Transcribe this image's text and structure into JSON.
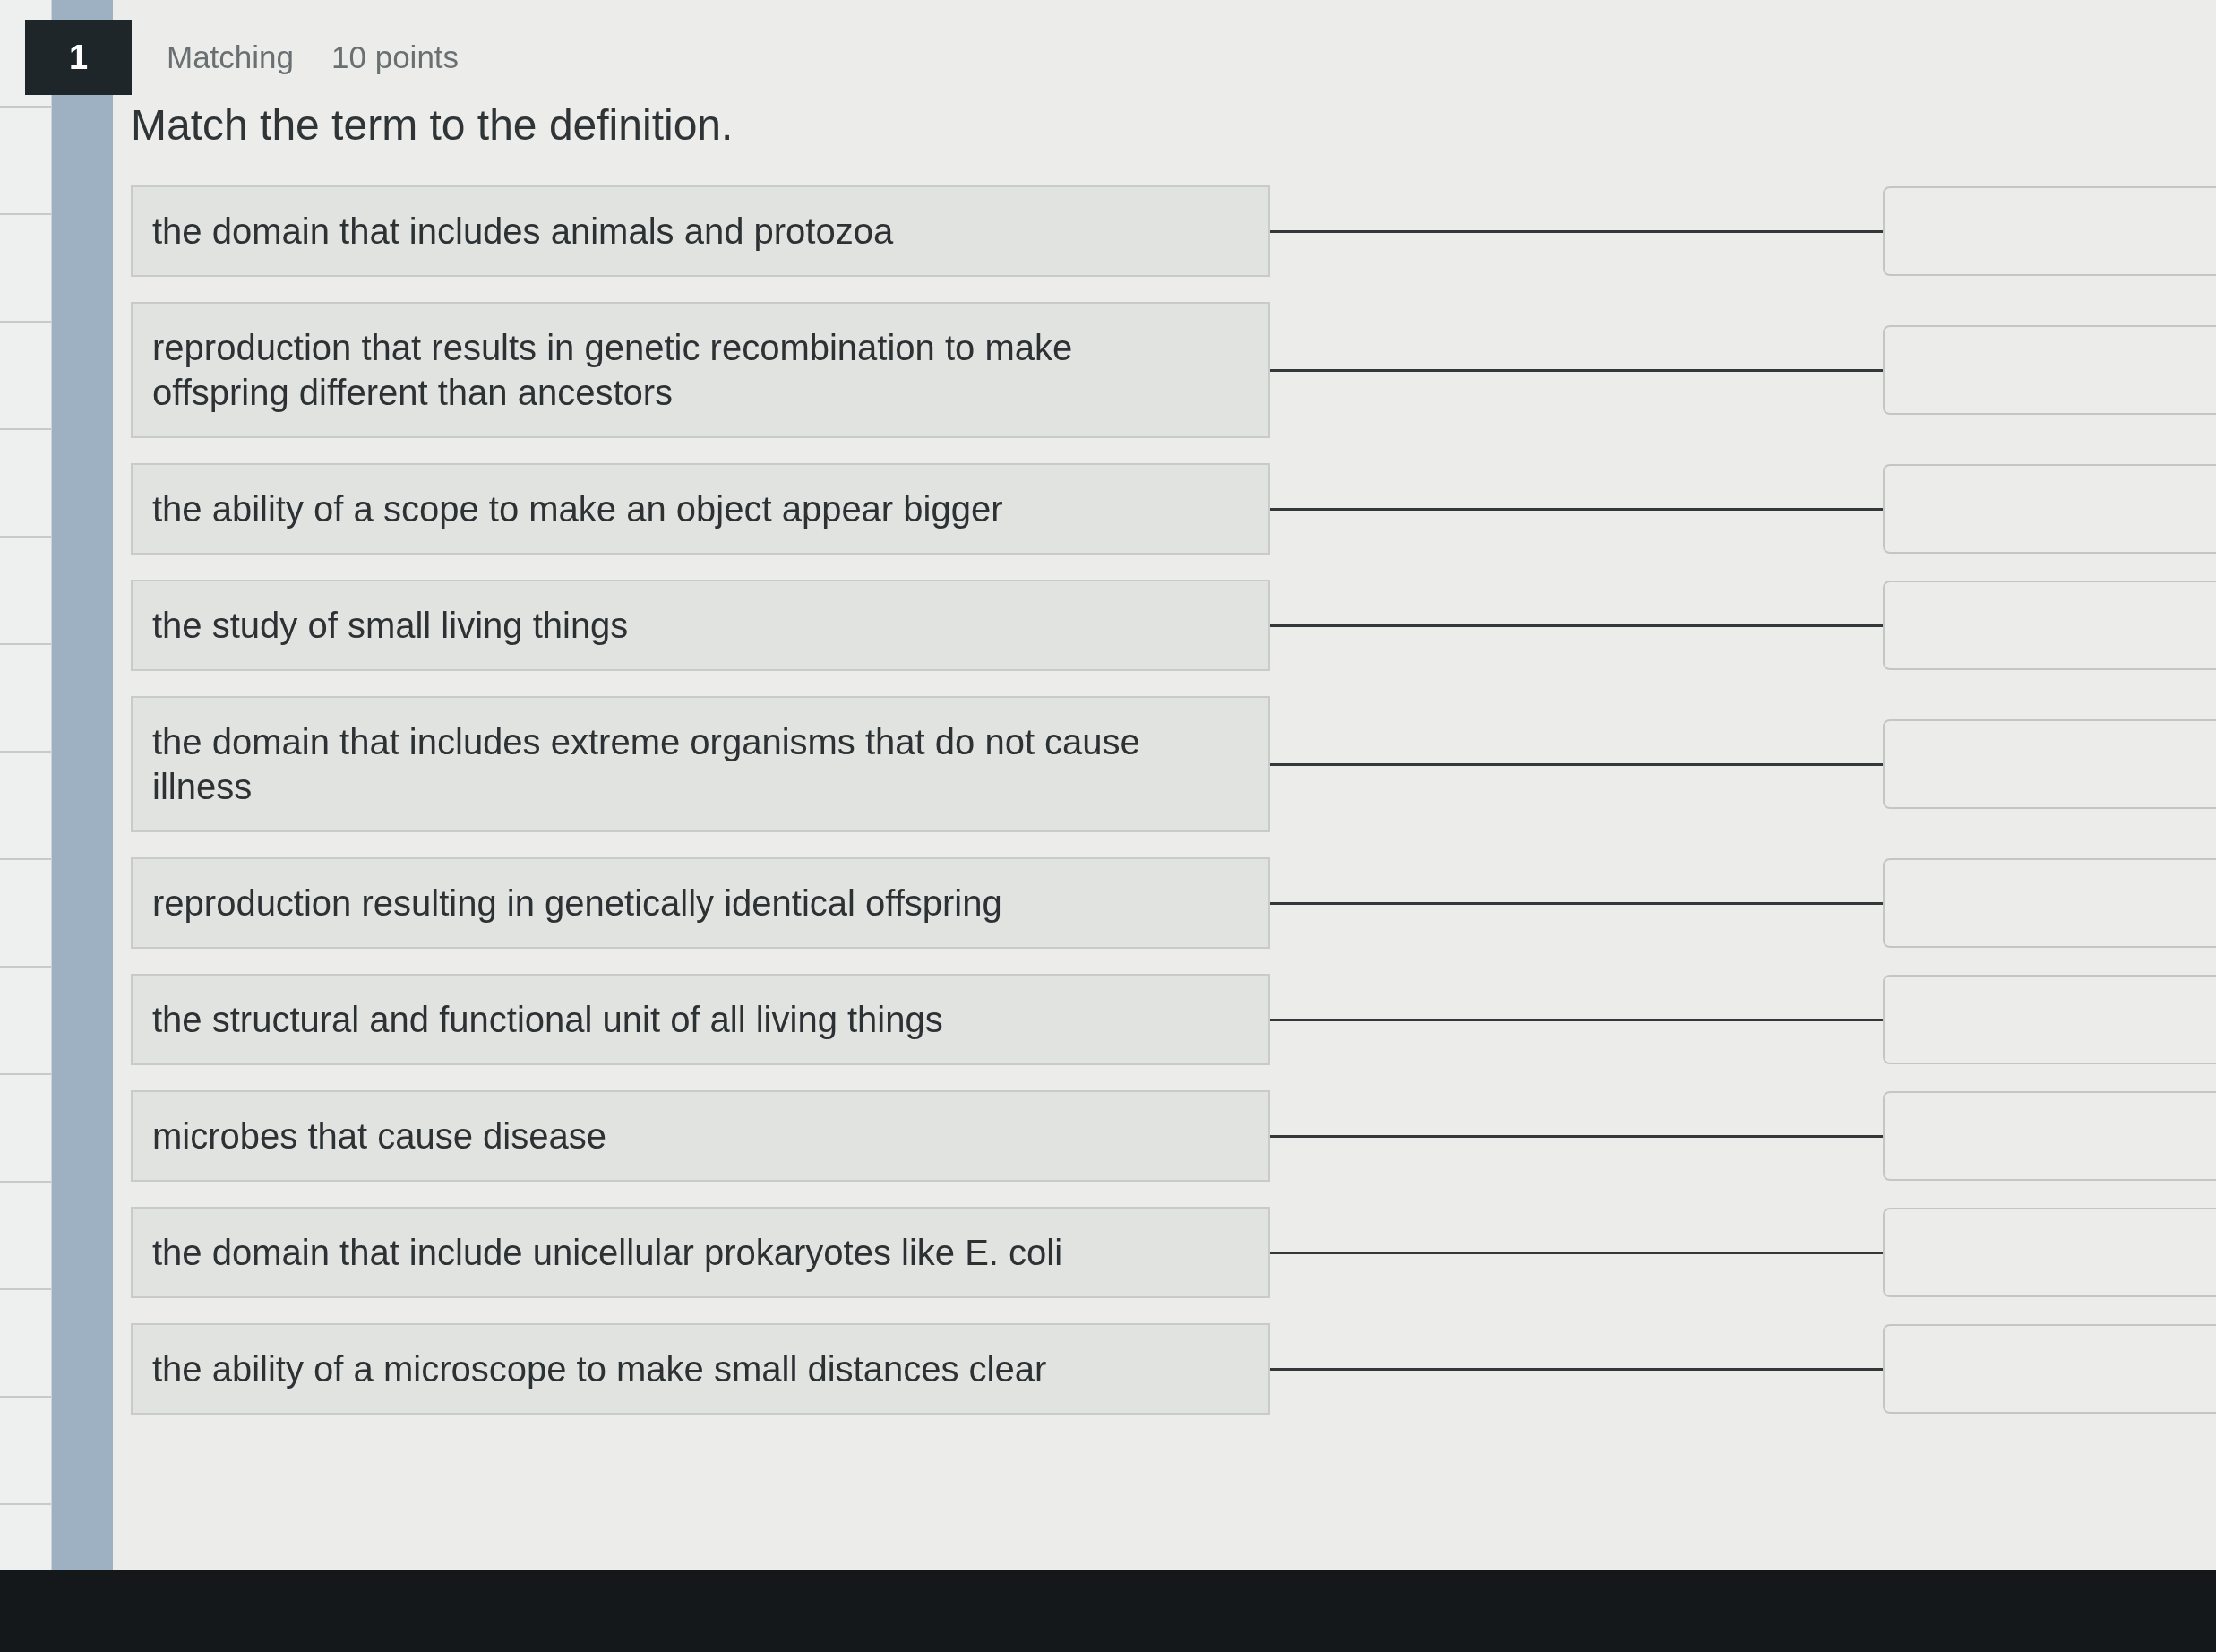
{
  "question": {
    "number": "1",
    "type": "Matching",
    "points": "10 points",
    "prompt": "Match the term to the definition."
  },
  "matches": [
    {
      "definition": "the domain that includes animals and protozoa"
    },
    {
      "definition": "reproduction that results in genetic recombination to make offspring different than ancestors"
    },
    {
      "definition": "the ability of a scope to make an object appear bigger"
    },
    {
      "definition": "the study of small living things"
    },
    {
      "definition": "the domain that includes extreme organisms that do not cause illness"
    },
    {
      "definition": "reproduction resulting in genetically identical offspring"
    },
    {
      "definition": "the structural and functional unit of all living things"
    },
    {
      "definition": "microbes that cause disease"
    },
    {
      "definition": "the domain that include unicellular prokaryotes like E. coli"
    },
    {
      "definition": "the ability of a microscope to make small distances clear"
    }
  ]
}
